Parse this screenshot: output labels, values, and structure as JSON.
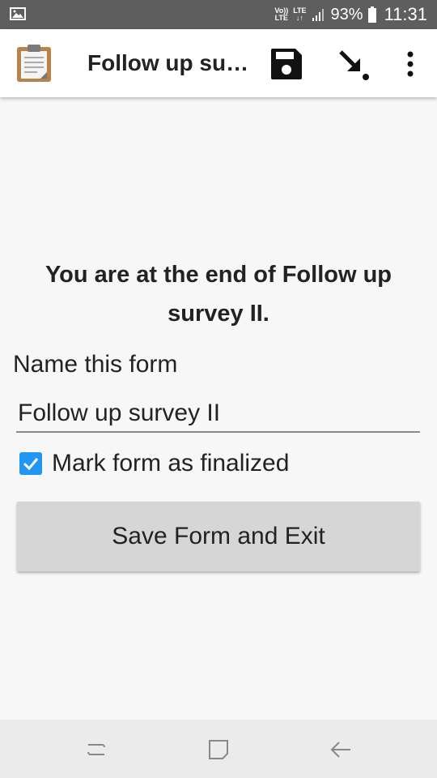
{
  "status_bar": {
    "network_top": "Vo))",
    "network_bottom": "LTE",
    "lte_label": "LTE",
    "battery_percent": "93%",
    "time": "11:31",
    "icons": [
      "gallery-icon",
      "signal-icon",
      "battery-icon"
    ]
  },
  "app_bar": {
    "title": "Follow up su…",
    "actions": [
      "save-icon",
      "go-to-icon",
      "overflow-menu-icon"
    ]
  },
  "form_end": {
    "heading": "You are at the end of Follow up survey II.",
    "name_label": "Name this form",
    "name_value": "Follow up survey II",
    "finalize_label": "Mark form as finalized",
    "finalize_checked": true,
    "save_button_label": "Save Form and Exit"
  },
  "nav_bar": {
    "buttons": [
      "recent-apps-icon",
      "home-icon",
      "back-icon"
    ]
  },
  "colors": {
    "status_bar": "#5e5e5e",
    "checkbox": "#2196f3",
    "button": "#d6d6d6",
    "background": "#f7f7f7"
  }
}
